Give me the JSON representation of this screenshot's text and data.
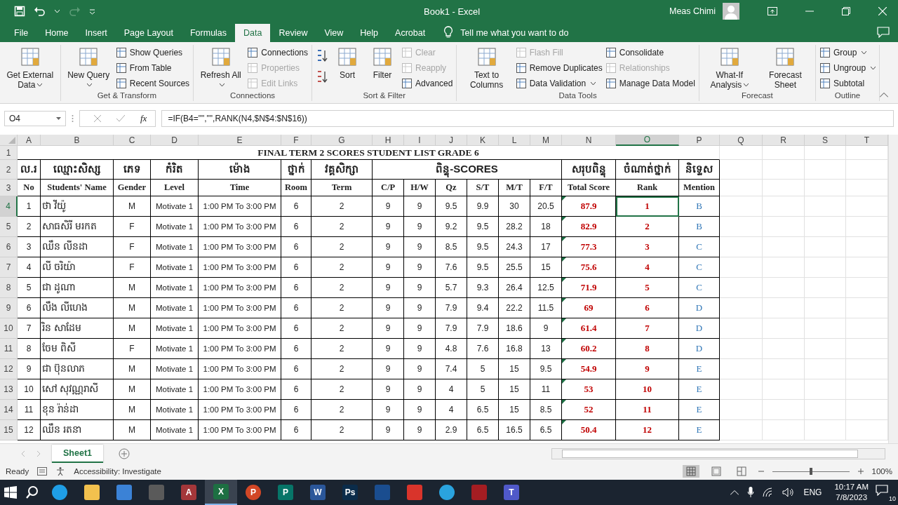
{
  "window": {
    "title": "Book1  -  Excel",
    "user": "Meas Chimi"
  },
  "tabs": [
    {
      "label": "File",
      "selected": false
    },
    {
      "label": "Home",
      "selected": false
    },
    {
      "label": "Insert",
      "selected": false
    },
    {
      "label": "Page Layout",
      "selected": false
    },
    {
      "label": "Formulas",
      "selected": false
    },
    {
      "label": "Data",
      "selected": true
    },
    {
      "label": "Review",
      "selected": false
    },
    {
      "label": "View",
      "selected": false
    },
    {
      "label": "Help",
      "selected": false
    },
    {
      "label": "Acrobat",
      "selected": false
    }
  ],
  "tell_me": {
    "placeholder": "Tell me what you want to do"
  },
  "ribbon": [
    {
      "columns": [
        {
          "kind": "large",
          "items": [
            {
              "label": "Get External Data",
              "menu": true,
              "disabled": false
            }
          ]
        }
      ]
    },
    {
      "label": "Get & Transform",
      "columns": [
        {
          "kind": "large",
          "items": [
            {
              "label": "New Query",
              "menu": true,
              "disabled": false
            }
          ]
        },
        {
          "kind": "small",
          "items": [
            {
              "label": "Show Queries",
              "disabled": false
            },
            {
              "label": "From Table",
              "disabled": false
            },
            {
              "label": "Recent Sources",
              "disabled": false
            }
          ]
        }
      ]
    },
    {
      "label": "Connections",
      "columns": [
        {
          "kind": "large",
          "items": [
            {
              "label": "Refresh All",
              "menu": true,
              "disabled": false
            }
          ]
        },
        {
          "kind": "small",
          "items": [
            {
              "label": "Connections",
              "disabled": false
            },
            {
              "label": "Properties",
              "disabled": true
            },
            {
              "label": "Edit Links",
              "disabled": true
            }
          ]
        }
      ]
    },
    {
      "label": "Sort & Filter",
      "columns": [
        {
          "kind": "sort-icons"
        },
        {
          "kind": "large",
          "items": [
            {
              "label": "Sort",
              "menu": false,
              "disabled": false
            }
          ]
        },
        {
          "kind": "large",
          "items": [
            {
              "label": "Filter",
              "menu": false,
              "disabled": false
            }
          ]
        },
        {
          "kind": "small",
          "items": [
            {
              "label": "Clear",
              "disabled": true
            },
            {
              "label": "Reapply",
              "disabled": true
            },
            {
              "label": "Advanced",
              "disabled": false
            }
          ]
        }
      ]
    },
    {
      "label": "Data Tools",
      "columns": [
        {
          "kind": "large",
          "items": [
            {
              "label": "Text to Columns",
              "menu": false,
              "disabled": false
            }
          ]
        },
        {
          "kind": "small",
          "items": [
            {
              "label": "Flash Fill",
              "disabled": true
            },
            {
              "label": "Remove Duplicates",
              "disabled": false
            },
            {
              "label": "Data Validation",
              "disabled": false,
              "menu": true
            }
          ]
        },
        {
          "kind": "small",
          "items": [
            {
              "label": "Consolidate",
              "disabled": false
            },
            {
              "label": "Relationships",
              "disabled": true
            },
            {
              "label": "Manage Data Model",
              "disabled": false
            }
          ]
        }
      ]
    },
    {
      "label": "Forecast",
      "columns": [
        {
          "kind": "large",
          "items": [
            {
              "label": "What-If Analysis",
              "menu": true,
              "disabled": false
            }
          ]
        },
        {
          "kind": "large",
          "items": [
            {
              "label": "Forecast Sheet",
              "menu": false,
              "disabled": false
            }
          ]
        }
      ]
    },
    {
      "label": "Outline",
      "columns": [
        {
          "kind": "small",
          "items": [
            {
              "label": "Group",
              "disabled": false,
              "menu": true
            },
            {
              "label": "Ungroup",
              "disabled": false,
              "menu": true
            },
            {
              "label": "Subtotal",
              "disabled": false
            }
          ]
        }
      ]
    }
  ],
  "formula_bar": {
    "name_box": "O4",
    "function_button": "fx",
    "formula": "=IF(B4=\"\",\"\",RANK(N4,$N$4:$N$16))"
  },
  "sheet": {
    "column_headers": [
      {
        "label": "A",
        "selected": false
      },
      {
        "label": "B",
        "selected": false
      },
      {
        "label": "C",
        "selected": false
      },
      {
        "label": "D",
        "selected": false
      },
      {
        "label": "E",
        "selected": false
      },
      {
        "label": "F",
        "selected": false
      },
      {
        "label": "G",
        "selected": false
      },
      {
        "label": "H",
        "selected": false
      },
      {
        "label": "I",
        "selected": false
      },
      {
        "label": "J",
        "selected": false
      },
      {
        "label": "K",
        "selected": false
      },
      {
        "label": "L",
        "selected": false
      },
      {
        "label": "M",
        "selected": false
      },
      {
        "label": "N",
        "selected": false
      },
      {
        "label": "O",
        "selected": true
      },
      {
        "label": "P",
        "selected": false
      },
      {
        "label": "Q",
        "selected": false
      },
      {
        "label": "R",
        "selected": false
      },
      {
        "label": "S",
        "selected": false
      },
      {
        "label": "T",
        "selected": false
      }
    ],
    "row_headers": [
      {
        "label": "1",
        "selected": false
      },
      {
        "label": "2",
        "selected": false
      },
      {
        "label": "3",
        "selected": false
      },
      {
        "label": "4",
        "selected": true
      },
      {
        "label": "5",
        "selected": false
      },
      {
        "label": "6",
        "selected": false
      },
      {
        "label": "7",
        "selected": false
      },
      {
        "label": "8",
        "selected": false
      },
      {
        "label": "9",
        "selected": false
      },
      {
        "label": "10",
        "selected": false
      },
      {
        "label": "11",
        "selected": false
      },
      {
        "label": "12",
        "selected": false
      },
      {
        "label": "13",
        "selected": false
      },
      {
        "label": "14",
        "selected": false
      },
      {
        "label": "15",
        "selected": false
      }
    ],
    "title": "FINAL TERM 2 SCORES STUDENT LIST GRADE 6",
    "khmer_headers": [
      {
        "label": "ល.រ",
        "kind": "single"
      },
      {
        "label": "ឈ្មោះសិស្ស",
        "kind": "single"
      },
      {
        "label": "ភេទ",
        "kind": "single"
      },
      {
        "label": "កំរិត",
        "kind": "single"
      },
      {
        "label": "ម៉ោង",
        "kind": "single"
      },
      {
        "label": "ថ្នាក់",
        "kind": "single"
      },
      {
        "label": "វគ្គសិក្សា",
        "kind": "single"
      },
      {
        "label": "ពិន្ទុ-SCORES",
        "kind": "group"
      },
      {
        "label": "សរុបពិន្ទុ",
        "kind": "single"
      },
      {
        "label": "ចំណាត់ថ្នាក់",
        "kind": "single"
      },
      {
        "label": "និទ្ទេស",
        "kind": "single"
      }
    ],
    "headers": [
      "No",
      "Students' Name",
      "Gender",
      "Level",
      "Time",
      "Room",
      "Term",
      "C/P",
      "H/W",
      "Qz",
      "S/T",
      "M/T",
      "F/T",
      "Total Score",
      "Rank",
      "Mention"
    ],
    "rows": [
      {
        "cells": [
          "1",
          "ថា វីយ៉ូ",
          "M",
          "Motivate 1",
          "1:00 PM To 3:00 PM",
          "6",
          "2",
          "9",
          "9",
          "9.5",
          "9.9",
          "30",
          "20.5",
          "87.9",
          "1",
          "B"
        ],
        "flagged": true,
        "rank_selected": true
      },
      {
        "cells": [
          "2",
          "សាធសិរី មរកត",
          "F",
          "Motivate 1",
          "1:00 PM To 3:00 PM",
          "6",
          "2",
          "9",
          "9",
          "9.2",
          "9.5",
          "28.2",
          "18",
          "82.9",
          "2",
          "B"
        ],
        "flagged": true,
        "rank_selected": false
      },
      {
        "cells": [
          "3",
          "ឈឹន លីនដា",
          "F",
          "Motivate 1",
          "1:00 PM To 3:00 PM",
          "6",
          "2",
          "9",
          "9",
          "8.5",
          "9.5",
          "24.3",
          "17",
          "77.3",
          "3",
          "C"
        ],
        "flagged": true,
        "rank_selected": false
      },
      {
        "cells": [
          "4",
          "លី ចរិយ៉ា",
          "F",
          "Motivate 1",
          "1:00 PM To 3:00 PM",
          "6",
          "2",
          "9",
          "9",
          "7.6",
          "9.5",
          "25.5",
          "15",
          "75.6",
          "4",
          "C"
        ],
        "flagged": true,
        "rank_selected": false
      },
      {
        "cells": [
          "5",
          "ជា ដូណា",
          "M",
          "Motivate 1",
          "1:00 PM To 3:00 PM",
          "6",
          "2",
          "9",
          "9",
          "5.7",
          "9.3",
          "26.4",
          "12.5",
          "71.9",
          "5",
          "C"
        ],
        "flagged": true,
        "rank_selected": false
      },
      {
        "cells": [
          "6",
          "លឹង លីហេង",
          "M",
          "Motivate 1",
          "1:00 PM To 3:00 PM",
          "6",
          "2",
          "9",
          "9",
          "7.9",
          "9.4",
          "22.2",
          "11.5",
          "69",
          "6",
          "D"
        ],
        "flagged": true,
        "rank_selected": false
      },
      {
        "cells": [
          "7",
          "រិន សាដែម",
          "M",
          "Motivate 1",
          "1:00 PM To 3:00 PM",
          "6",
          "2",
          "9",
          "9",
          "7.9",
          "7.9",
          "18.6",
          "9",
          "61.4",
          "7",
          "D"
        ],
        "flagged": true,
        "rank_selected": false
      },
      {
        "cells": [
          "8",
          "ចែម ពិសី",
          "F",
          "Motivate 1",
          "1:00 PM To 3:00 PM",
          "6",
          "2",
          "9",
          "9",
          "4.8",
          "7.6",
          "16.8",
          "13",
          "60.2",
          "8",
          "D"
        ],
        "flagged": true,
        "rank_selected": false
      },
      {
        "cells": [
          "9",
          "ជា ប៊ុនលាភ",
          "M",
          "Motivate 1",
          "1:00 PM To 3:00 PM",
          "6",
          "2",
          "9",
          "9",
          "7.4",
          "5",
          "15",
          "9.5",
          "54.9",
          "9",
          "E"
        ],
        "flagged": true,
        "rank_selected": false
      },
      {
        "cells": [
          "10",
          "សៅ សុវណ្ណរាសី",
          "M",
          "Motivate 1",
          "1:00 PM To 3:00 PM",
          "6",
          "2",
          "9",
          "9",
          "4",
          "5",
          "15",
          "11",
          "53",
          "10",
          "E"
        ],
        "flagged": true,
        "rank_selected": false
      },
      {
        "cells": [
          "11",
          "ខុន រ៉ាន់ដា",
          "M",
          "Motivate 1",
          "1:00 PM To 3:00 PM",
          "6",
          "2",
          "9",
          "9",
          "4",
          "6.5",
          "15",
          "8.5",
          "52",
          "11",
          "E"
        ],
        "flagged": true,
        "rank_selected": false
      },
      {
        "cells": [
          "12",
          "ឈឹន រតនា",
          "M",
          "Motivate 1",
          "1:00 PM To 3:00 PM",
          "6",
          "2",
          "9",
          "9",
          "2.9",
          "6.5",
          "16.5",
          "6.5",
          "50.4",
          "12",
          "E"
        ],
        "flagged": true,
        "rank_selected": false
      }
    ]
  },
  "sheet_tabs": [
    {
      "label": "Sheet1",
      "selected": true
    }
  ],
  "status_bar": {
    "status": "Ready",
    "accessibility": "Accessibility: Investigate",
    "zoom": "100%",
    "zoom_slider": {
      "level": 0.5
    }
  },
  "taskbar": {
    "apps": [
      {
        "kind": "round",
        "color": "#1f9ee6",
        "active": false
      },
      {
        "kind": "tile",
        "color": "#f2c14e",
        "active": false
      },
      {
        "kind": "tile",
        "color": "#3b82d6",
        "active": false
      },
      {
        "kind": "tile",
        "color": "#5a5a5a",
        "active": false
      },
      {
        "kind": "tile",
        "color": "#a4373a",
        "glyph": "A",
        "active": false
      },
      {
        "kind": "tile",
        "color": "#1d6f42",
        "glyph": "X",
        "active": true
      },
      {
        "kind": "round",
        "color": "#d24726",
        "glyph": "P",
        "active": false
      },
      {
        "kind": "tile",
        "color": "#077568",
        "glyph": "P",
        "active": false
      },
      {
        "kind": "tile",
        "color": "#2b579a",
        "glyph": "W",
        "active": false
      },
      {
        "kind": "tile",
        "color": "#0b2c4a",
        "glyph": "Ps",
        "active": false
      },
      {
        "kind": "tile",
        "color": "#1a4d8f",
        "active": false
      },
      {
        "kind": "tile",
        "color": "#d9342b",
        "active": false
      },
      {
        "kind": "round",
        "color": "#2aa3de",
        "active": false
      },
      {
        "kind": "tile",
        "color": "#a41d22",
        "active": false
      },
      {
        "kind": "tile",
        "color": "#5059c9",
        "glyph": "T",
        "active": false
      }
    ],
    "language": "ENG",
    "time": "10:17 AM",
    "date": "7/8/2023",
    "notifications": "10"
  }
}
